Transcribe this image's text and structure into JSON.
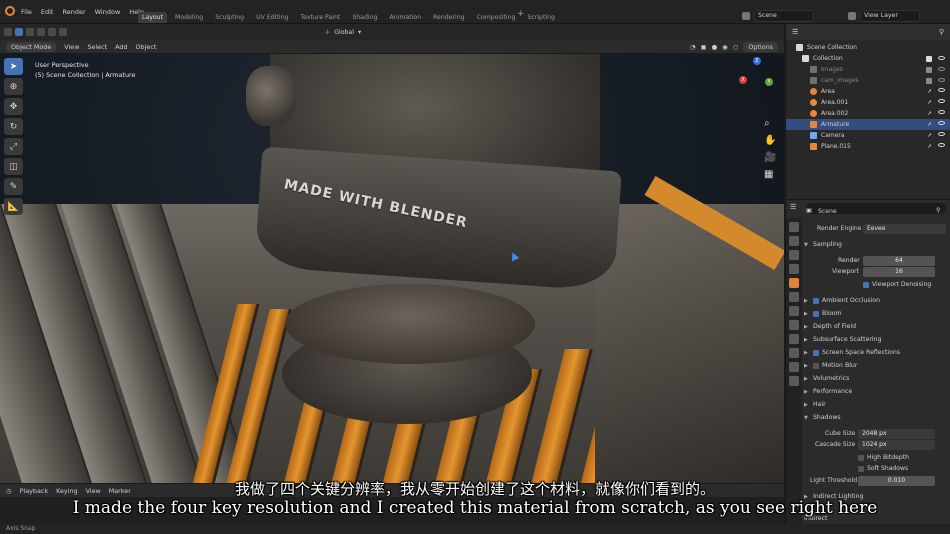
{
  "topbar": {
    "menu": [
      "File",
      "Edit",
      "Render",
      "Window",
      "Help"
    ],
    "workspaces": [
      "Layout",
      "Modeling",
      "Sculpting",
      "UV Editing",
      "Texture Paint",
      "Shading",
      "Animation",
      "Rendering",
      "Compositing",
      "Scripting"
    ],
    "active_workspace": "Layout",
    "scene": "Scene",
    "view_layer": "View Layer"
  },
  "viewport_header": {
    "mode": "Object Mode",
    "menus": [
      "View",
      "Select",
      "Add",
      "Object"
    ],
    "transform_orientation": "Global",
    "options": "Options"
  },
  "viewport": {
    "view_name": "User Perspective",
    "collection_path": "(5) Scene Collection | Armature",
    "band_text": "MADE WITH BLENDER",
    "gizmo": {
      "x": "X",
      "y": "Y",
      "z": "Z"
    }
  },
  "timeline": {
    "menus": [
      "Playback",
      "Keying",
      "View",
      "Marker"
    ]
  },
  "statusbar": {
    "text": "Axis Snap"
  },
  "outliner": {
    "header": "Scene Collection",
    "rows": [
      {
        "label": "Collection",
        "selected": false
      },
      {
        "label": "Images",
        "selected": false
      },
      {
        "label": "cam_images",
        "selected": false
      },
      {
        "label": "Area",
        "selected": false
      },
      {
        "label": "Area.001",
        "selected": false
      },
      {
        "label": "Area.002",
        "selected": false
      },
      {
        "label": "Armature",
        "selected": true
      },
      {
        "label": "Camera",
        "selected": false
      },
      {
        "label": "Plane.015",
        "selected": false
      }
    ]
  },
  "properties": {
    "context": "Scene",
    "render_engine_label": "Render Engine",
    "render_engine": "Eevee",
    "sampling": {
      "label": "Sampling",
      "render_label": "Render",
      "render_value": "64",
      "viewport_label": "Viewport",
      "viewport_value": "16",
      "denoise_label": "Viewport Denoising"
    },
    "sections": [
      {
        "label": "Ambient Occlusion",
        "checked": true
      },
      {
        "label": "Bloom",
        "checked": true
      },
      {
        "label": "Depth of Field",
        "checked": null
      },
      {
        "label": "Subsurface Scattering",
        "checked": null
      },
      {
        "label": "Screen Space Reflections",
        "checked": true
      },
      {
        "label": "Motion Blur",
        "checked": false
      },
      {
        "label": "Volumetrics",
        "checked": null
      },
      {
        "label": "Performance",
        "checked": null
      },
      {
        "label": "Hair",
        "checked": null
      }
    ],
    "shadows": {
      "label": "Shadows",
      "cube_size_label": "Cube Size",
      "cube_size": "2048 px",
      "cascade_size_label": "Cascade Size",
      "cascade_size": "1024 px",
      "high_bitdepth": "High Bitdepth",
      "soft_shadows": "Soft Shadows",
      "light_threshold_label": "Light Threshold",
      "light_threshold": "0.010"
    },
    "indirect_lighting": "Indirect Lighting",
    "indirect_tab": "Indirect"
  },
  "subtitles": {
    "chinese": "我做了四个关键分辨率，我从零开始创建了这个材料，就像你们看到的。",
    "english": "I made the four key resolution and I created this material from scratch, as you see right here"
  },
  "colors": {
    "accent": "#4772b3",
    "selection": "#334d80",
    "blender_orange": "#e7873b"
  }
}
